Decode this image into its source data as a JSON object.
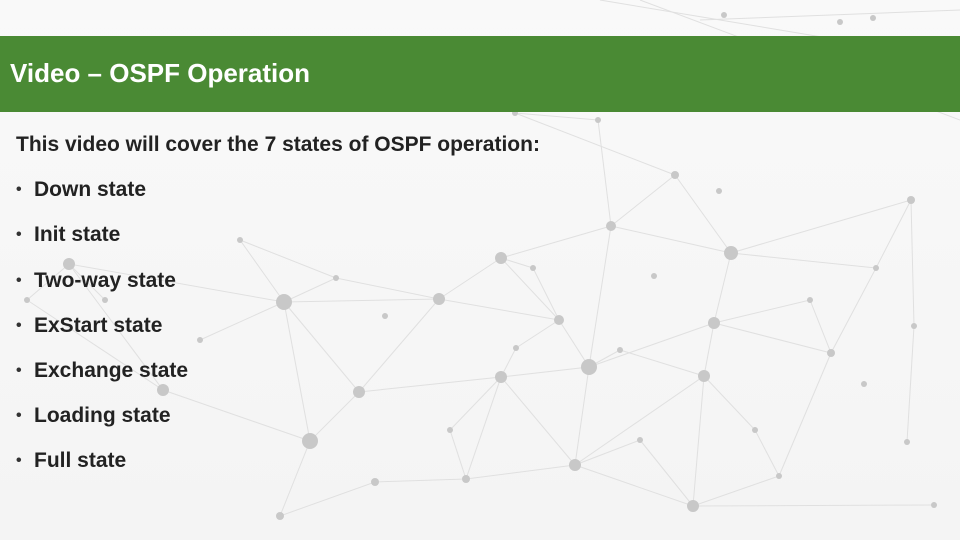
{
  "slide": {
    "title": "Video – OSPF Operation",
    "intro": "This video will cover the 7 states of OSPF operation:",
    "bullet_glyph": "•",
    "states": [
      "Down state",
      "Init state",
      "Two-way state",
      "ExStart state",
      "Exchange state",
      "Loading state",
      "Full state"
    ]
  },
  "colors": {
    "title_bar": "#4a8a34",
    "title_text": "#ffffff",
    "body_text": "#222222",
    "network_node": "#c8c8c8",
    "network_line": "#e0e0e0"
  },
  "icons": {
    "background": "network-graph-pattern"
  }
}
